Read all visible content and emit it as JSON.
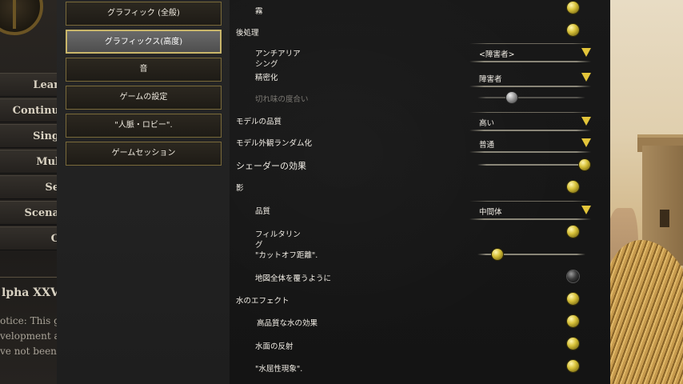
{
  "main_menu": {
    "items": [
      "Lear",
      "Continu",
      "Sing",
      "Mul",
      "Se",
      "Scena",
      "C"
    ],
    "version": "lpha XXVI",
    "notice_lines": [
      "otice: This ga",
      "velopment a",
      "ve not been"
    ]
  },
  "nav": {
    "items": [
      "グラフィック (全般)",
      "グラフィックス(高度)",
      "音",
      "ゲームの設定",
      "\"人脈・ロビー\".",
      "ゲームセッション"
    ],
    "active_index": 1
  },
  "settings": {
    "fog": {
      "label": "霧",
      "on": true
    },
    "postprocessing": {
      "label": "後処理",
      "on": true
    },
    "antialiasing": {
      "label_line1": "アンチアリア",
      "label_line2": "シング",
      "value": "<障害者>"
    },
    "sharpening": {
      "label": "精密化",
      "value": "障害者"
    },
    "sharpness_factor": {
      "label": "切れ味の度合い",
      "level": 0.3
    },
    "model_quality": {
      "label": "モデルの品質",
      "value": "高い"
    },
    "model_variation": {
      "label": "モデル外観ランダム化",
      "value": "普通"
    },
    "shader_effects": {
      "label": "シェーダーの効果",
      "level": 1.0
    },
    "shadows": {
      "label": "影",
      "on": true
    },
    "shadow_quality": {
      "label": "品質",
      "value": "中間体"
    },
    "shadow_filtering": {
      "label_line1": "フィルタリン",
      "label_line2": "グ",
      "on": true
    },
    "shadow_cutoff": {
      "label": "\"カットオフ距離\".",
      "level": 0.15
    },
    "cover_whole_map": {
      "label": "地図全体を覆うように",
      "on": false
    },
    "water_effects": {
      "label": "水のエフェクト",
      "on": true
    },
    "high_quality_water": {
      "label": "高品質な水の効果",
      "on": true
    },
    "water_reflections": {
      "label": "水面の反射",
      "on": true
    },
    "water_refraction": {
      "label": "\"水屈性現象\".",
      "on": true
    }
  },
  "colors": {
    "accent_gold": "#e3c53a",
    "nav_border": "#7a6a3a",
    "active_border": "#c9b66a"
  }
}
